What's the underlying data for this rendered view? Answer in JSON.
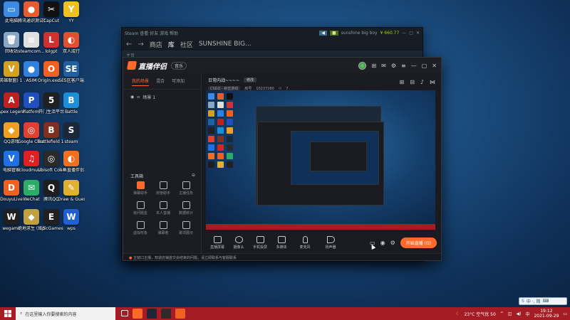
{
  "desktop": {
    "icons": [
      {
        "label": "此电脑",
        "color": "#3c8be0",
        "glyph": "▭",
        "icon": "computer-icon"
      },
      {
        "label": "腾讯通识测试客户端（后...",
        "color": "#e85b2c",
        "glyph": "●",
        "icon": "app-icon"
      },
      {
        "label": "CapCut",
        "color": "#111111",
        "glyph": "✂",
        "icon": "capcut-icon"
      },
      {
        "label": "YY",
        "color": "#f0c020",
        "glyph": "Y",
        "icon": "yy-icon"
      },
      {
        "label": "回收站",
        "color": "#8aa6c0",
        "glyph": "🗑",
        "icon": "recycle-bin-icon"
      },
      {
        "label": "steamcom...",
        "color": "#e0e0e0",
        "glyph": "≡",
        "icon": "file-icon"
      },
      {
        "label": "lolgpt",
        "color": "#d03030",
        "glyph": "L",
        "icon": "app-icon"
      },
      {
        "label": "双人成行",
        "color": "#e05030",
        "glyph": "◐",
        "icon": "game-icon"
      },
      {
        "label": "(英雄联盟) 1 ...",
        "color": "#d4a020",
        "glyph": "V",
        "icon": "lol-icon"
      },
      {
        "label": "ASIM",
        "color": "#3080e0",
        "glyph": "●",
        "icon": "app-icon"
      },
      {
        "label": "Origin.exe - 快捷方式",
        "color": "#f06020",
        "glyph": "O",
        "icon": "origin-icon"
      },
      {
        "label": "SE5区客户端",
        "color": "#2060a0",
        "glyph": "SE",
        "icon": "app-icon"
      },
      {
        "label": "Apex Legends",
        "color": "#c02020",
        "glyph": "A",
        "icon": "apex-icon"
      },
      {
        "label": "Platform",
        "color": "#2050c0",
        "glyph": "P",
        "icon": "platform-icon"
      },
      {
        "label": "开门生活平台",
        "color": "#202020",
        "glyph": "5",
        "icon": "app-icon"
      },
      {
        "label": "Battle",
        "color": "#1b8fd8",
        "glyph": "B",
        "icon": "battlenet-icon"
      },
      {
        "label": "QQ游戏",
        "color": "#f0a020",
        "glyph": "◆",
        "icon": "qq-game-icon"
      },
      {
        "label": "Google Chrome",
        "color": "#e04030",
        "glyph": "◎",
        "icon": "chrome-icon"
      },
      {
        "label": "Battlefield 1 ...",
        "color": "#803020",
        "glyph": "B",
        "icon": "game-icon"
      },
      {
        "label": "steam",
        "color": "#1b2838",
        "glyph": "S",
        "icon": "steam-icon"
      },
      {
        "label": "电脑管家",
        "color": "#1f70e0",
        "glyph": "V",
        "icon": "pc-manager-icon"
      },
      {
        "label": "cloudmusic",
        "color": "#e02020",
        "glyph": "♫",
        "icon": "cloudmusic-icon"
      },
      {
        "label": "Ubisoft Connect",
        "color": "#2a2a2a",
        "glyph": "◎",
        "icon": "ubisoft-icon"
      },
      {
        "label": "斗鱼直播伴侣",
        "color": "#f07020",
        "glyph": "◐",
        "icon": "douyu-icon"
      },
      {
        "label": "DouyuLive",
        "color": "#f06020",
        "glyph": "D",
        "icon": "douyu-icon"
      },
      {
        "label": "WeChat",
        "color": "#2aae67",
        "glyph": "✉",
        "icon": "wechat-icon"
      },
      {
        "label": "腾讯QQ",
        "color": "#1e1e1e",
        "glyph": "Q",
        "icon": "qq-icon"
      },
      {
        "label": "Draw & Guess",
        "color": "#e0b030",
        "glyph": "✎",
        "icon": "game-icon"
      },
      {
        "label": "wegame",
        "color": "#202020",
        "glyph": "W",
        "icon": "wegame-icon"
      },
      {
        "label": "绝地求生 (纯享版) 平台",
        "color": "#c0a040",
        "glyph": "◆",
        "icon": "pubg-icon"
      },
      {
        "label": "EpicGames",
        "color": "#202020",
        "glyph": "E",
        "icon": "epic-icon"
      },
      {
        "label": "wps",
        "color": "#2060d0",
        "glyph": "W",
        "icon": "wps-icon"
      }
    ]
  },
  "steam": {
    "topbar_left": "Steam 查看 好友 游戏 帮助",
    "user": "sunshine big boy",
    "wallet": "¥ 660.77",
    "nav": {
      "back": "←",
      "forward": "→",
      "items": [
        "商店",
        "库",
        "社区",
        "SUNSHINE BIG..."
      ]
    },
    "sub": "主页"
  },
  "zb": {
    "title": "直播伴侣",
    "badge": "音乐",
    "tabs": [
      "我的场景",
      "混合",
      "可添加"
    ],
    "scene": "场景 1",
    "tools_title": "工具箱",
    "tools": [
      {
        "label": "弹幕助手",
        "hot": true
      },
      {
        "label": "房管助手",
        "hot": false
      },
      {
        "label": "主播任务",
        "hot": false
      },
      {
        "label": "抢问题星",
        "hot": false
      },
      {
        "label": "本人直播",
        "hot": false
      },
      {
        "label": "数据统计",
        "hot": false
      },
      {
        "label": "虚拟形象",
        "hot": false
      },
      {
        "label": "弹幕卷",
        "hot": false
      },
      {
        "label": "歌词展示",
        "hot": false
      }
    ],
    "room_title": "日常内战~~~~",
    "room_btn": "修改",
    "category": "CSGO · 射击游戏",
    "room_id_label": "房号",
    "room_id": "10237280",
    "fans": "7",
    "bottom_buttons": [
      "直播屏幕",
      "摄像头",
      "手机投屏",
      "多媒体",
      "麦克风",
      "扬声器"
    ],
    "live_button": "开始直播 (G)",
    "footer": "主窗口主播，知道店铺首交会结束的问题，请立即联系与客服联系"
  },
  "taskbar": {
    "search_placeholder": "在这里输入你要搜索的内容",
    "weather": "23°C 空气优 50",
    "time": "19:12",
    "date": "2021-09-29",
    "lang": "中"
  },
  "ime": {
    "label": "中 ·, 简"
  }
}
